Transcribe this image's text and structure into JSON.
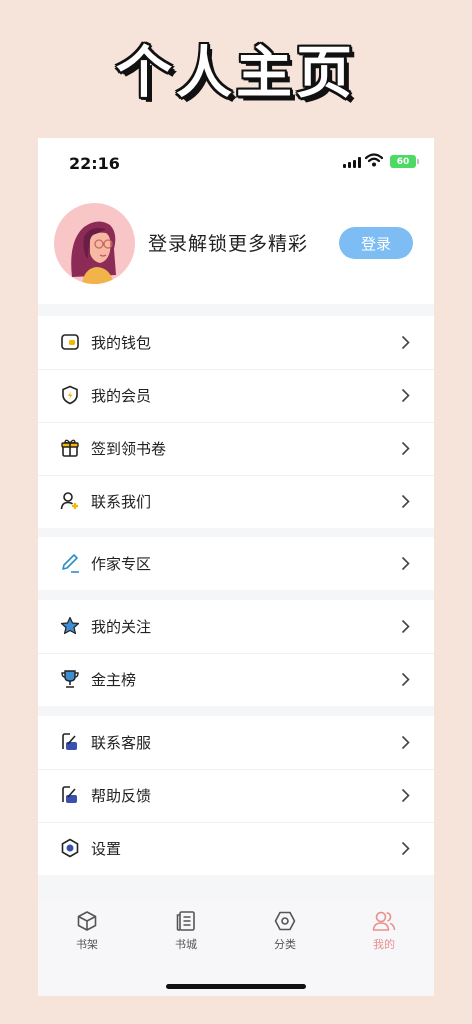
{
  "banner": {
    "title": "个人主页"
  },
  "status_bar": {
    "time": "22:16",
    "battery": "60"
  },
  "profile": {
    "prompt": "登录解锁更多精彩",
    "login_label": "登录"
  },
  "menu": {
    "group1": [
      {
        "label": "我的钱包",
        "icon": "wallet-icon"
      },
      {
        "label": "我的会员",
        "icon": "member-shield-icon"
      },
      {
        "label": "签到领书卷",
        "icon": "gift-icon"
      },
      {
        "label": "联系我们",
        "icon": "contact-user-icon"
      }
    ],
    "group2": [
      {
        "label": "作家专区",
        "icon": "pen-icon"
      }
    ],
    "group3": [
      {
        "label": "我的关注",
        "icon": "star-icon"
      },
      {
        "label": "金主榜",
        "icon": "trophy-icon"
      }
    ],
    "group4": [
      {
        "label": "联系客服",
        "icon": "customer-service-icon"
      },
      {
        "label": "帮助反馈",
        "icon": "feedback-icon"
      },
      {
        "label": "设置",
        "icon": "settings-icon"
      }
    ]
  },
  "tabbar": {
    "items": [
      {
        "label": "书架",
        "icon": "bookshelf-icon"
      },
      {
        "label": "书城",
        "icon": "bookstore-icon"
      },
      {
        "label": "分类",
        "icon": "category-icon"
      },
      {
        "label": "我的",
        "icon": "profile-icon"
      }
    ],
    "active": "我的"
  },
  "colors": {
    "accent": "#7ebdf3",
    "active_tab": "#e9908f",
    "page_background": "#f6e3da"
  }
}
